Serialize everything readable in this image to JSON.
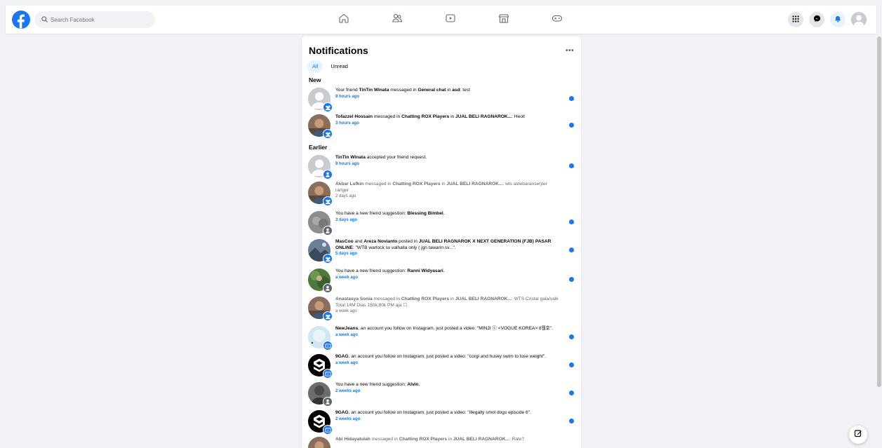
{
  "search": {
    "placeholder": "Search Facebook"
  },
  "nav": {
    "icons": [
      "home-icon",
      "friends-icon",
      "watch-icon",
      "marketplace-icon",
      "gaming-icon"
    ],
    "right_icons": [
      "menu-grid-icon",
      "messenger-icon",
      "bell-icon",
      "profile-avatar"
    ]
  },
  "notifications": {
    "title": "Notifications",
    "more": "•••",
    "filters": [
      "All",
      "Unread"
    ],
    "active_filter": "All",
    "sections": [
      {
        "label": "New",
        "items": [
          {
            "parts": [
              [
                "",
                "Your friend "
              ],
              [
                "b",
                "TinTin Winata"
              ],
              [
                "",
                " messaged in "
              ],
              [
                "b",
                "General chat"
              ],
              [
                "",
                " in "
              ],
              [
                "b",
                "asd"
              ],
              [
                "",
                ": test"
              ]
            ],
            "time": "9 hours ago",
            "unread": true,
            "badge": "group-icon",
            "avatar": "default"
          },
          {
            "parts": [
              [
                "b",
                "Tofazzel Hossain"
              ],
              [
                "",
                " messaged in "
              ],
              [
                "b",
                "Chatting ROX Players"
              ],
              [
                "",
                " in "
              ],
              [
                "b",
                "JUAL BELI RAGNAROK..."
              ],
              [
                "",
                ": Heoll"
              ]
            ],
            "time": "3 hours ago",
            "unread": true,
            "badge": "group-icon",
            "avatar": "person"
          }
        ]
      },
      {
        "label": "Earlier",
        "items": [
          {
            "parts": [
              [
                "b",
                "TinTin Winata"
              ],
              [
                "",
                " accepted your friend request."
              ]
            ],
            "time": "9 hours ago",
            "unread": true,
            "badge": "person-icon",
            "avatar": "default"
          },
          {
            "parts": [
              [
                "b",
                "Akbar Lufkin"
              ],
              [
                "",
                " messaged in "
              ],
              [
                "b",
                "Chatting ROX Players"
              ],
              [
                "",
                " in "
              ],
              [
                "b",
                "JUAL BELI RAGNAROK..."
              ],
              [
                "",
                ": wts aldebaranserper ranger"
              ]
            ],
            "time": "2 days ago",
            "unread": false,
            "badge": "group-icon",
            "avatar": "person"
          },
          {
            "parts": [
              [
                "",
                "You have a new friend suggestion: "
              ],
              [
                "b",
                "Blessing Bimbel"
              ],
              [
                "",
                "."
              ]
            ],
            "time": "3 days ago",
            "unread": true,
            "badge": "person-add-icon",
            "avatar": "gray"
          },
          {
            "parts": [
              [
                "b",
                "MasCoo"
              ],
              [
                "",
                " and "
              ],
              [
                "b",
                "Areza Novianto"
              ],
              [
                "",
                " posted in "
              ],
              [
                "b",
                "JUAL BELI RAGNAROK X NEXT GENERATION (FJB) PASAR ONLINE"
              ],
              [
                "",
                ": \"WTB warlock sv valhalla only ( jgn tawarin sv...\"."
              ]
            ],
            "time": "5 days ago",
            "unread": true,
            "badge": "group-icon",
            "avatar": "scene"
          },
          {
            "parts": [
              [
                "",
                "You have a new friend suggestion: "
              ],
              [
                "b",
                "Ranni Widyasari"
              ],
              [
                "",
                "."
              ]
            ],
            "time": "a week ago",
            "unread": true,
            "badge": "person-add-icon",
            "avatar": "green"
          },
          {
            "parts": [
              [
                "b",
                "Anastasya Sonia"
              ],
              [
                "",
                " messaged in "
              ],
              [
                "b",
                "Chatting ROX Players"
              ],
              [
                "",
                " in "
              ],
              [
                "b",
                "JUAL BELI RAGNAROK..."
              ],
              [
                "",
                ": WTS Cristal gaia/valk Total 14M Dias 150k,80k PM aja ☐"
              ]
            ],
            "time": "a week ago",
            "unread": false,
            "badge": "group-icon",
            "avatar": "person"
          },
          {
            "parts": [
              [
                "b",
                "NewJeans"
              ],
              [
                "",
                ", an account you follow on Instagram, just posted a video: \"MINJI ⓒ <VOGUE KOREA> 8월호\"."
              ]
            ],
            "time": "a week ago",
            "unread": true,
            "badge": "video-icon",
            "avatar": "light"
          },
          {
            "parts": [
              [
                "b",
                "9GAG"
              ],
              [
                "",
                ", an account you follow on Instagram, just posted a video: \"corgi and husky swim to lose weight\"."
              ]
            ],
            "time": "a week ago",
            "unread": true,
            "badge": "video-icon",
            "avatar": "ninegag"
          },
          {
            "parts": [
              [
                "",
                "You have a new friend suggestion: "
              ],
              [
                "b",
                "Alvin"
              ],
              [
                "",
                "."
              ]
            ],
            "time": "2 weeks ago",
            "unread": true,
            "badge": "person-add-icon",
            "avatar": "dark"
          },
          {
            "parts": [
              [
                "b",
                "9GAG"
              ],
              [
                "",
                ", an account you follow on Instagram, just posted a video: \"illegally smol dogs episode 6\"."
              ]
            ],
            "time": "2 weeks ago",
            "unread": true,
            "badge": "video-icon",
            "avatar": "ninegag"
          },
          {
            "parts": [
              [
                "b",
                "Abi Hidayatulah"
              ],
              [
                "",
                " messaged in "
              ],
              [
                "b",
                "Chatting ROX Players"
              ],
              [
                "",
                " in "
              ],
              [
                "b",
                "JUAL BELI RAGNAROK..."
              ],
              [
                "",
                ": Rate?"
              ]
            ],
            "time": "",
            "unread": false,
            "badge": "group-icon",
            "avatar": "person"
          }
        ]
      }
    ]
  },
  "colors": {
    "accent": "#1877f2",
    "background": "#f0f2f5",
    "card": "#ffffff",
    "secondary_text": "#65676b"
  }
}
